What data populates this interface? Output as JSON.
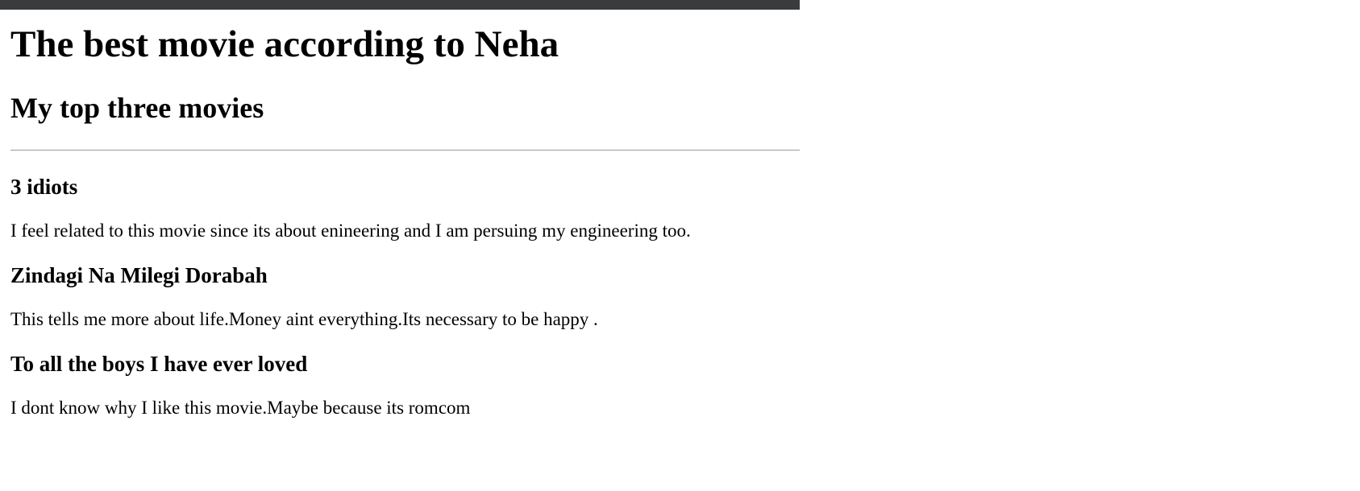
{
  "page": {
    "title": "The best movie according to Neha",
    "subtitle": "My top three movies",
    "colors": {
      "top_bar": "#3a3b3d",
      "divider": "#9a9a9a",
      "text": "#000000",
      "background": "#ffffff"
    }
  },
  "movies": [
    {
      "name": "3 idiots",
      "description": "I feel related to this movie since its about enineering and I am persuing my engineering too."
    },
    {
      "name": "Zindagi Na Milegi Dorabah",
      "description": "This tells me more about life.Money aint everything.Its necessary to be happy ."
    },
    {
      "name": "To all the boys I have ever loved",
      "description": "I dont know why I like this movie.Maybe because its romcom"
    }
  ]
}
